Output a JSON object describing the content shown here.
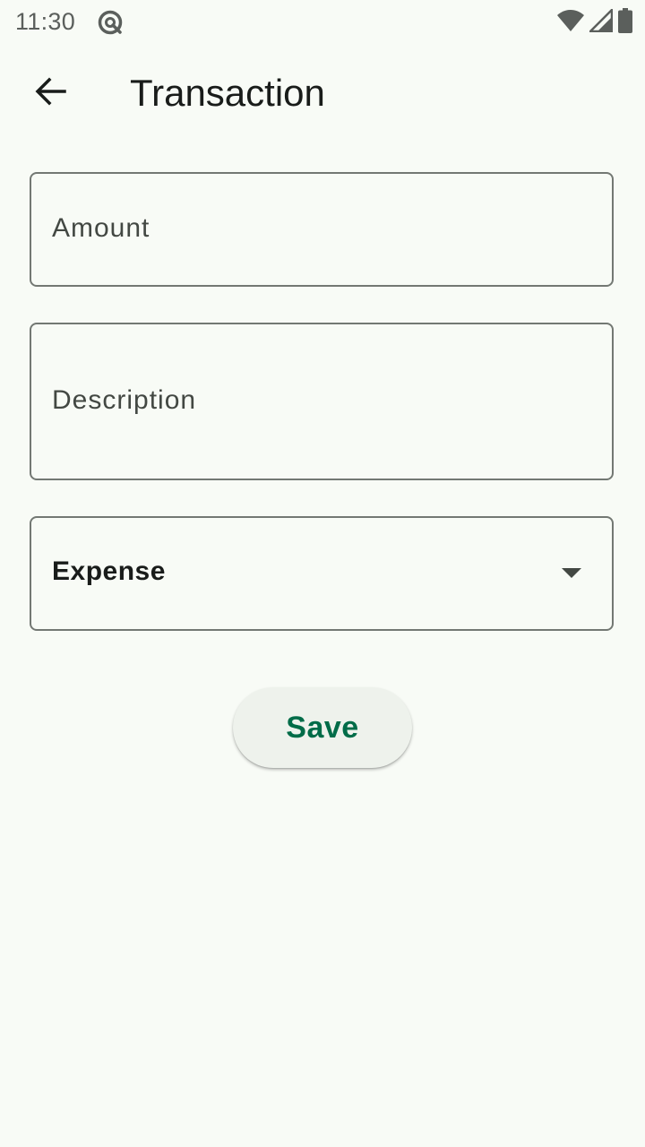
{
  "status_bar": {
    "time": "11:30",
    "icons": [
      "app-notification-icon",
      "wifi-icon",
      "signal-icon",
      "battery-icon"
    ]
  },
  "app_bar": {
    "back_icon": "arrow-back-icon",
    "title": "Transaction"
  },
  "form": {
    "amount": {
      "value": "",
      "placeholder": "Amount"
    },
    "description": {
      "value": "",
      "placeholder": "Description"
    },
    "type": {
      "selected": "Expense",
      "icon": "dropdown-arrow-icon"
    },
    "save_label": "Save"
  },
  "colors": {
    "background": "#f8fbf6",
    "accent": "#006c48",
    "outline": "#737873",
    "button_surface": "#eef2ec"
  }
}
